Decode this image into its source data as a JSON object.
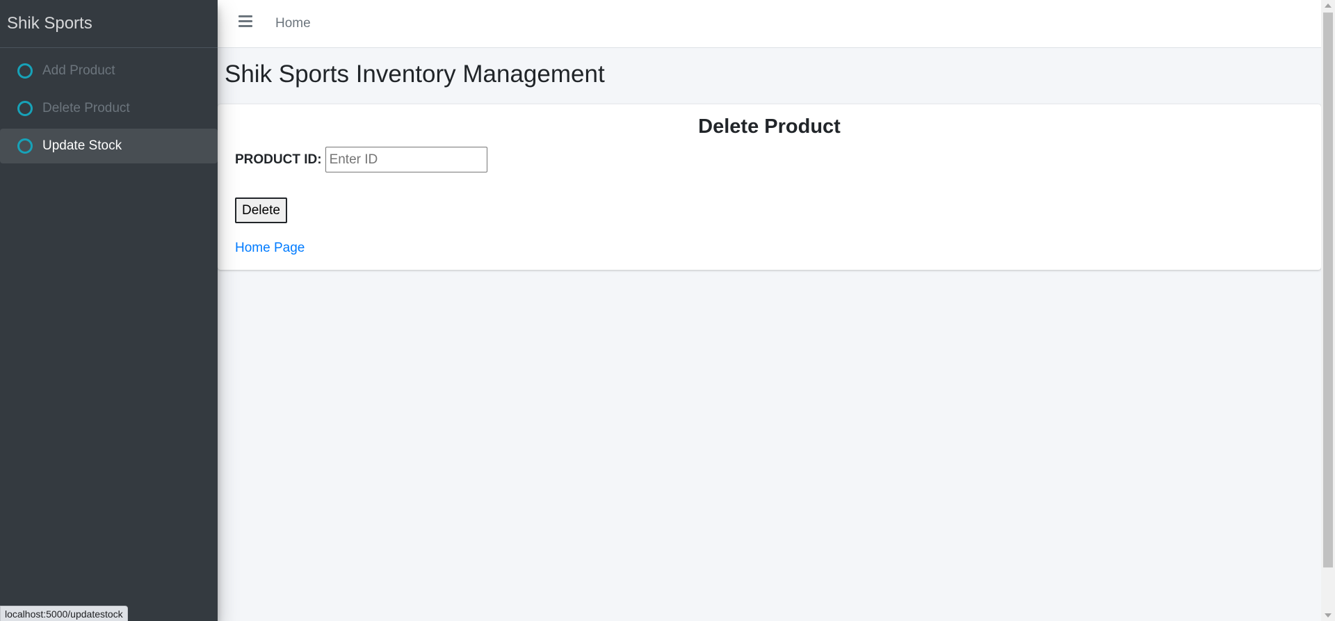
{
  "sidebar": {
    "brand": "Shik Sports",
    "items": [
      {
        "label": "Add Product",
        "icon": "circle-icon",
        "active": false
      },
      {
        "label": "Delete Product",
        "icon": "circle-icon",
        "active": false
      },
      {
        "label": "Update Stock",
        "icon": "circle-icon",
        "active": true
      }
    ]
  },
  "topbar": {
    "menu_icon": "hamburger-icon",
    "home_label": "Home"
  },
  "main": {
    "page_title": "Shik Sports Inventory Management",
    "card": {
      "title": "Delete Product",
      "product_id_label": "PRODUCT ID:",
      "product_id_placeholder": "Enter ID",
      "product_id_value": "",
      "delete_label": "Delete",
      "home_link_label": "Home Page"
    }
  },
  "status_bar": {
    "url": "localhost:5000/updatestock"
  },
  "colors": {
    "sidebar_bg": "#343a40",
    "accent_circle": "#17a2b8",
    "link": "#007bff",
    "content_bg": "#f4f6f9"
  }
}
